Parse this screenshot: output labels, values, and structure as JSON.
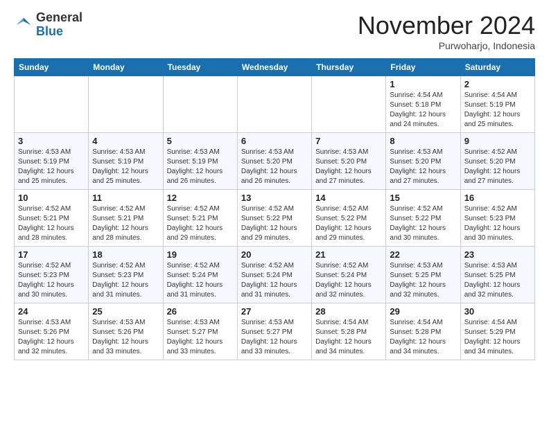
{
  "logo": {
    "general": "General",
    "blue": "Blue"
  },
  "title": "November 2024",
  "location": "Purwoharjo, Indonesia",
  "days_of_week": [
    "Sunday",
    "Monday",
    "Tuesday",
    "Wednesday",
    "Thursday",
    "Friday",
    "Saturday"
  ],
  "weeks": [
    [
      {
        "day": "",
        "info": ""
      },
      {
        "day": "",
        "info": ""
      },
      {
        "day": "",
        "info": ""
      },
      {
        "day": "",
        "info": ""
      },
      {
        "day": "",
        "info": ""
      },
      {
        "day": "1",
        "info": "Sunrise: 4:54 AM\nSunset: 5:18 PM\nDaylight: 12 hours and 24 minutes."
      },
      {
        "day": "2",
        "info": "Sunrise: 4:54 AM\nSunset: 5:19 PM\nDaylight: 12 hours and 25 minutes."
      }
    ],
    [
      {
        "day": "3",
        "info": "Sunrise: 4:53 AM\nSunset: 5:19 PM\nDaylight: 12 hours and 25 minutes."
      },
      {
        "day": "4",
        "info": "Sunrise: 4:53 AM\nSunset: 5:19 PM\nDaylight: 12 hours and 25 minutes."
      },
      {
        "day": "5",
        "info": "Sunrise: 4:53 AM\nSunset: 5:19 PM\nDaylight: 12 hours and 26 minutes."
      },
      {
        "day": "6",
        "info": "Sunrise: 4:53 AM\nSunset: 5:20 PM\nDaylight: 12 hours and 26 minutes."
      },
      {
        "day": "7",
        "info": "Sunrise: 4:53 AM\nSunset: 5:20 PM\nDaylight: 12 hours and 27 minutes."
      },
      {
        "day": "8",
        "info": "Sunrise: 4:53 AM\nSunset: 5:20 PM\nDaylight: 12 hours and 27 minutes."
      },
      {
        "day": "9",
        "info": "Sunrise: 4:52 AM\nSunset: 5:20 PM\nDaylight: 12 hours and 27 minutes."
      }
    ],
    [
      {
        "day": "10",
        "info": "Sunrise: 4:52 AM\nSunset: 5:21 PM\nDaylight: 12 hours and 28 minutes."
      },
      {
        "day": "11",
        "info": "Sunrise: 4:52 AM\nSunset: 5:21 PM\nDaylight: 12 hours and 28 minutes."
      },
      {
        "day": "12",
        "info": "Sunrise: 4:52 AM\nSunset: 5:21 PM\nDaylight: 12 hours and 29 minutes."
      },
      {
        "day": "13",
        "info": "Sunrise: 4:52 AM\nSunset: 5:22 PM\nDaylight: 12 hours and 29 minutes."
      },
      {
        "day": "14",
        "info": "Sunrise: 4:52 AM\nSunset: 5:22 PM\nDaylight: 12 hours and 29 minutes."
      },
      {
        "day": "15",
        "info": "Sunrise: 4:52 AM\nSunset: 5:22 PM\nDaylight: 12 hours and 30 minutes."
      },
      {
        "day": "16",
        "info": "Sunrise: 4:52 AM\nSunset: 5:23 PM\nDaylight: 12 hours and 30 minutes."
      }
    ],
    [
      {
        "day": "17",
        "info": "Sunrise: 4:52 AM\nSunset: 5:23 PM\nDaylight: 12 hours and 30 minutes."
      },
      {
        "day": "18",
        "info": "Sunrise: 4:52 AM\nSunset: 5:23 PM\nDaylight: 12 hours and 31 minutes."
      },
      {
        "day": "19",
        "info": "Sunrise: 4:52 AM\nSunset: 5:24 PM\nDaylight: 12 hours and 31 minutes."
      },
      {
        "day": "20",
        "info": "Sunrise: 4:52 AM\nSunset: 5:24 PM\nDaylight: 12 hours and 31 minutes."
      },
      {
        "day": "21",
        "info": "Sunrise: 4:52 AM\nSunset: 5:24 PM\nDaylight: 12 hours and 32 minutes."
      },
      {
        "day": "22",
        "info": "Sunrise: 4:53 AM\nSunset: 5:25 PM\nDaylight: 12 hours and 32 minutes."
      },
      {
        "day": "23",
        "info": "Sunrise: 4:53 AM\nSunset: 5:25 PM\nDaylight: 12 hours and 32 minutes."
      }
    ],
    [
      {
        "day": "24",
        "info": "Sunrise: 4:53 AM\nSunset: 5:26 PM\nDaylight: 12 hours and 32 minutes."
      },
      {
        "day": "25",
        "info": "Sunrise: 4:53 AM\nSunset: 5:26 PM\nDaylight: 12 hours and 33 minutes."
      },
      {
        "day": "26",
        "info": "Sunrise: 4:53 AM\nSunset: 5:27 PM\nDaylight: 12 hours and 33 minutes."
      },
      {
        "day": "27",
        "info": "Sunrise: 4:53 AM\nSunset: 5:27 PM\nDaylight: 12 hours and 33 minutes."
      },
      {
        "day": "28",
        "info": "Sunrise: 4:54 AM\nSunset: 5:28 PM\nDaylight: 12 hours and 34 minutes."
      },
      {
        "day": "29",
        "info": "Sunrise: 4:54 AM\nSunset: 5:28 PM\nDaylight: 12 hours and 34 minutes."
      },
      {
        "day": "30",
        "info": "Sunrise: 4:54 AM\nSunset: 5:29 PM\nDaylight: 12 hours and 34 minutes."
      }
    ]
  ]
}
